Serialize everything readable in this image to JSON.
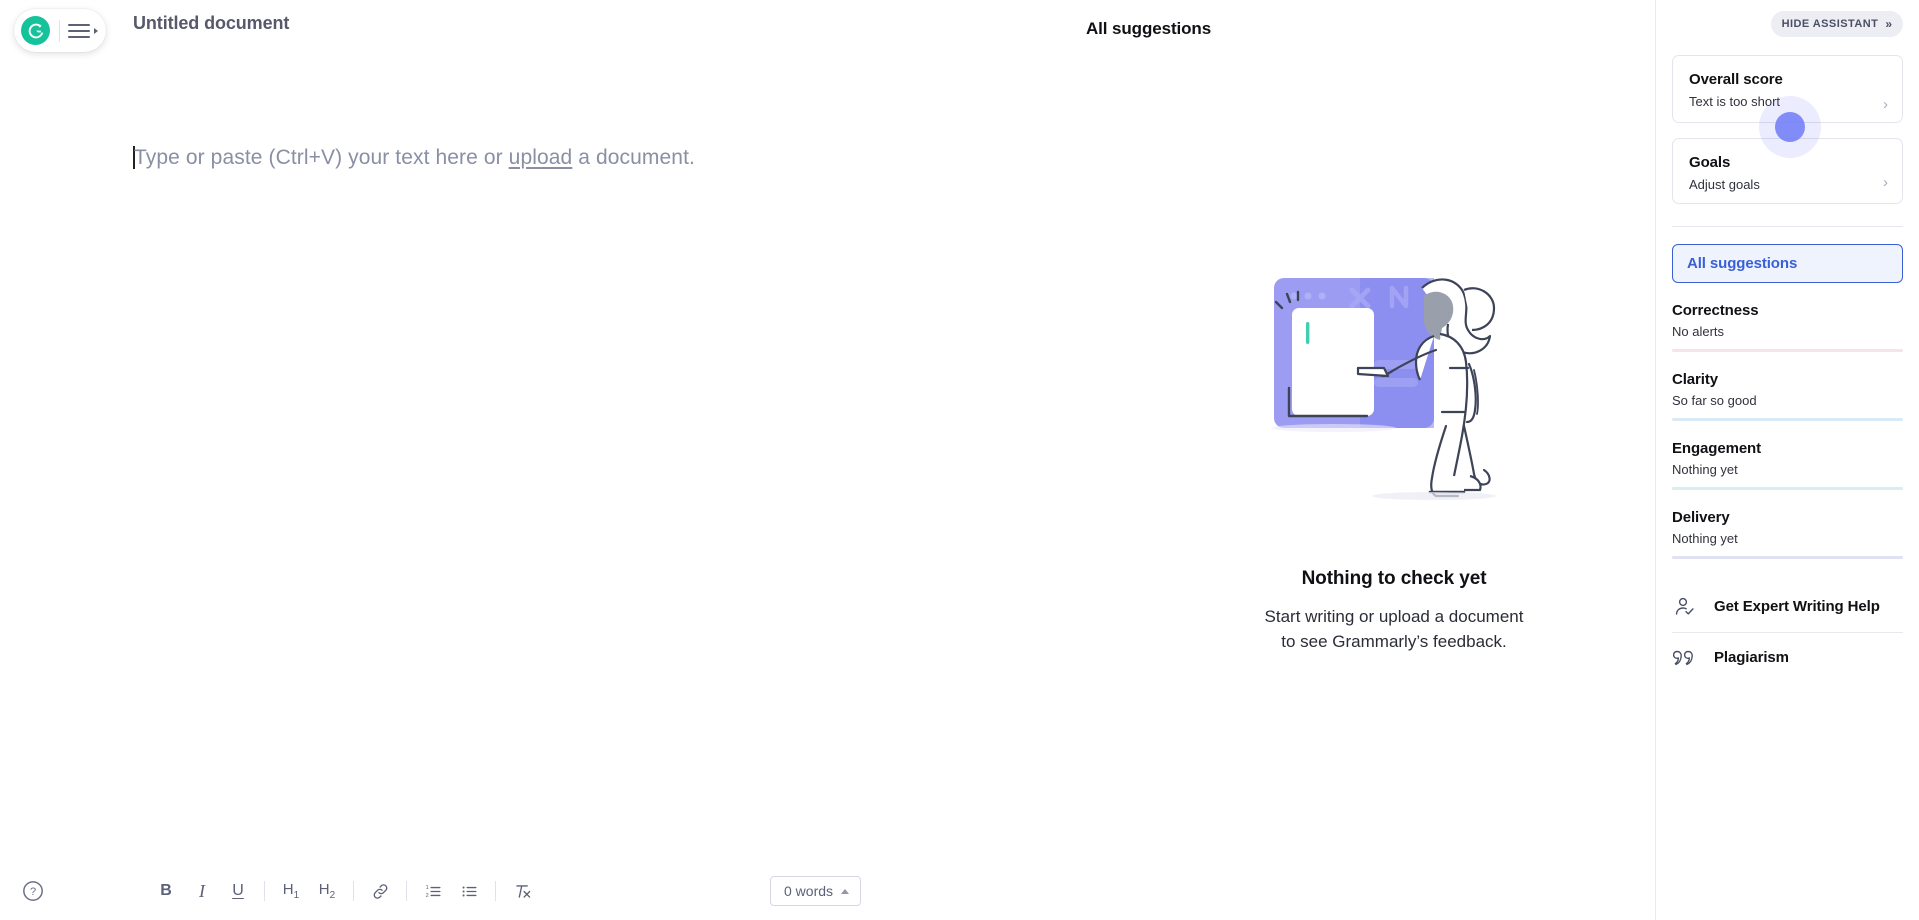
{
  "app": {
    "logo_name": "grammarly-logo",
    "brand_color": "#15c39a"
  },
  "header": {
    "document_title": "Untitled document",
    "suggestions_title": "All suggestions"
  },
  "editor": {
    "placeholder_prefix": "Type or paste (Ctrl+V) your text here or ",
    "placeholder_link": "upload",
    "placeholder_suffix": " a document."
  },
  "empty_state": {
    "title": "Nothing to check yet",
    "line1": "Start writing or upload a document",
    "line2": "to see Grammarly’s feedback."
  },
  "toolbar": {
    "help_label": "?",
    "bold": "B",
    "italic": "I",
    "underline": "U",
    "h1": "H",
    "h1_sub": "1",
    "h2": "H",
    "h2_sub": "2",
    "link": "link-icon",
    "numbered_list": "numbered-list-icon",
    "bullet_list": "bullet-list-icon",
    "clear_format": "clear-formatting-icon",
    "word_count": "0 words"
  },
  "sidebar": {
    "hide_assistant": "HIDE ASSISTANT",
    "hide_assistant_chevron": "»",
    "overall_score": {
      "title": "Overall score",
      "subtitle": "Text is too short",
      "chevron": "›"
    },
    "goals": {
      "title": "Goals",
      "subtitle": "Adjust goals",
      "chevron": "›"
    },
    "all_suggestions": "All suggestions",
    "categories": [
      {
        "title": "Correctness",
        "status": "No alerts",
        "color": "#f6e4e6"
      },
      {
        "title": "Clarity",
        "status": "So far so good",
        "color": "#d9e9f7"
      },
      {
        "title": "Engagement",
        "status": "Nothing yet",
        "color": "#d9edf2"
      },
      {
        "title": "Delivery",
        "status": "Nothing yet",
        "color": "#e0e1f2"
      }
    ],
    "footer": [
      {
        "label": "Get Expert Writing Help",
        "icon": "expert-person-check-icon"
      },
      {
        "label": "Plagiarism",
        "icon": "quote-marks-icon"
      }
    ]
  }
}
